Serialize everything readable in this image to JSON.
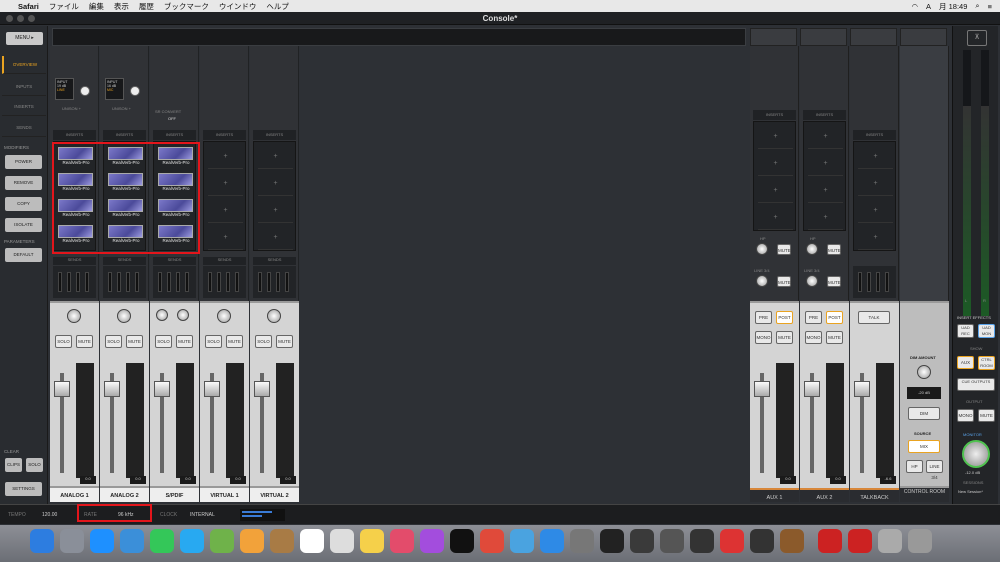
{
  "menubar": {
    "app": "Safari",
    "items": [
      "ファイル",
      "編集",
      "表示",
      "履歴",
      "ブックマーク",
      "ウインドウ",
      "ヘルプ"
    ],
    "time": "月 18:49",
    "input": "A"
  },
  "window": {
    "title": "Console*"
  },
  "left": {
    "menu": "MENU ▸",
    "nav": [
      "OVERVIEW",
      "INPUTS",
      "INSERTS",
      "SENDS"
    ],
    "modifiers_label": "MODIFIERS",
    "modifiers": [
      "POWER",
      "REMOVE",
      "COPY",
      "ISOLATE"
    ],
    "parameters_label": "PARAMETERS",
    "parameters": [
      "DEFAULT"
    ],
    "clear_label": "CLEAR",
    "clear": [
      "CLIPS",
      "SOLO"
    ],
    "settings": "SETTINGS"
  },
  "labels": {
    "inserts": "INSERTS",
    "sends": "SENDS",
    "solo": "SOLO",
    "mute": "MUTE",
    "input": "INPUT",
    "unison": "UNISON +",
    "plus": "+",
    "pre": "PRE",
    "post": "POST",
    "mono": "MONO",
    "hp": "HP",
    "line34": "LINE 3/4",
    "talk": "TALK",
    "dim_amount": "DIM AMOUNT",
    "dim_value": "-20 dB",
    "dim": "DIM",
    "source": "SOURCE",
    "mix": "MIX",
    "hp_btn": "HP",
    "line_btn": "LINE 3/4",
    "sr_convert": "SR CONVERT",
    "sr_off": "OFF"
  },
  "channels": [
    {
      "name": "ANALOG 1",
      "preamp_gain": "19 dB",
      "preamp_type": "LINE",
      "fader_db": "0.0"
    },
    {
      "name": "ANALOG 2",
      "preamp_gain": "16 dB",
      "preamp_type": "MIC",
      "fader_db": "0.0"
    },
    {
      "name": "S/PDIF",
      "fader_db": "0.0"
    },
    {
      "name": "VIRTUAL 1",
      "fader_db": "0.0"
    },
    {
      "name": "VIRTUAL 2",
      "fader_db": "0.0"
    }
  ],
  "plugin_name": "RealVerb-Pro",
  "aux": [
    {
      "name": "AUX 1",
      "fader_db": "0.0"
    },
    {
      "name": "AUX 2",
      "fader_db": "0.0"
    }
  ],
  "talkback": {
    "name": "TALKBACK",
    "fader_db": "-6.6"
  },
  "control_room": {
    "name": "CONTROL ROOM"
  },
  "monitor": {
    "insert_effects": "INSERT EFFECTS",
    "uad_rec": "UAD REC",
    "uad_mon": "UAD MON",
    "show": "SHOW",
    "aux": "AUX",
    "ctrl_room": "CTRL ROOM",
    "cue_outputs": "CUE OUTPUTS",
    "output": "OUTPUT",
    "mono": "MONO",
    "mute": "MUTE",
    "monitor_label": "MONITOR",
    "monitor_db": "-12.0 dB",
    "sessions": "SESSIONS",
    "session_name": "New Session*",
    "l": "L",
    "r": "R"
  },
  "bottom": {
    "tempo_label": "TEMPO",
    "tempo": "120.00",
    "rate_label": "RATE",
    "rate": "96 kHz",
    "clock_label": "CLOCK",
    "clock": "INTERNAL"
  },
  "scale": [
    "12",
    "6",
    "0",
    "3",
    "6",
    "10",
    "15",
    "20",
    "30",
    "40",
    "50",
    "∞"
  ],
  "colors": {
    "highlight": "#e3151b",
    "accent": "#e9a321"
  }
}
